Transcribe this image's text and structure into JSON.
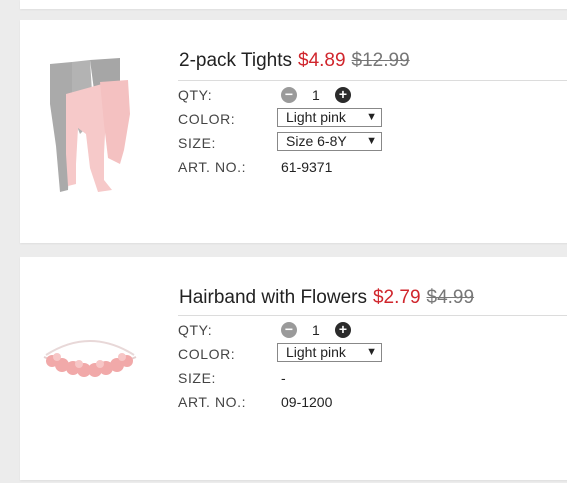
{
  "items": [
    {
      "name": "2-pack Tights",
      "sale_price": "$4.89",
      "original_price": "$12.99",
      "labels": {
        "qty": "QTY:",
        "color": "COLOR:",
        "size": "SIZE:",
        "art": "ART. NO.:"
      },
      "qty": "1",
      "color": "Light pink",
      "size": "Size  6-8Y",
      "art_no": "61-9371"
    },
    {
      "name": "Hairband with Flowers",
      "sale_price": "$2.79",
      "original_price": "$4.99",
      "labels": {
        "qty": "QTY:",
        "color": "COLOR:",
        "size": "SIZE:",
        "art": "ART. NO.:"
      },
      "qty": "1",
      "color": "Light pink",
      "size": "-",
      "art_no": "09-1200"
    }
  ],
  "icons": {
    "minus": "minus-circle-icon",
    "plus": "plus-circle-icon",
    "caret": "caret-down-icon"
  },
  "colors": {
    "sale_price": "#d0262d",
    "background": "#ececec",
    "card": "#ffffff"
  },
  "glyphs": {
    "minus": "−",
    "plus": "+",
    "caret": "▼"
  }
}
